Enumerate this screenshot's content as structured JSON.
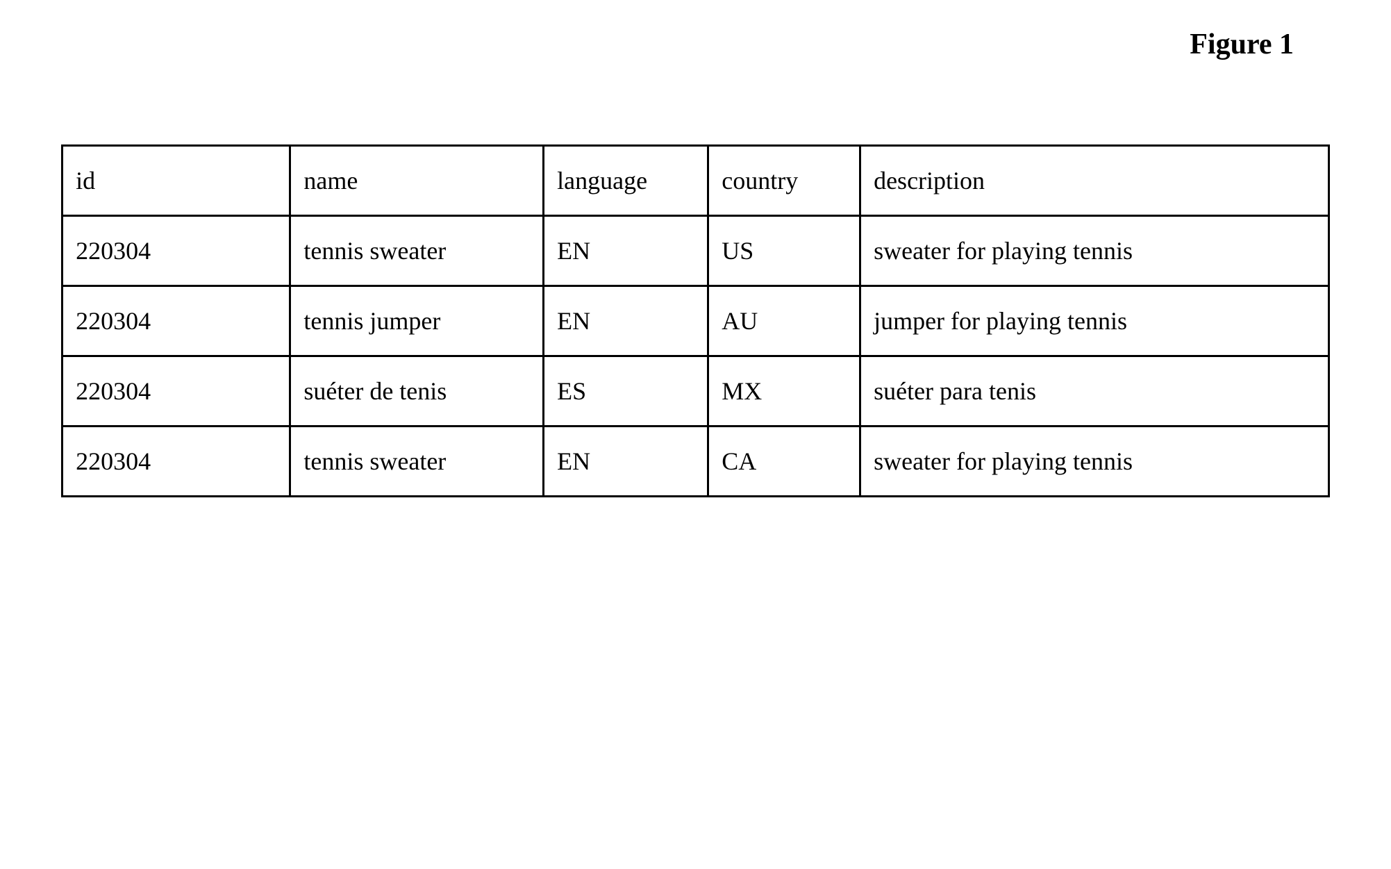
{
  "title": "Figure 1",
  "table": {
    "headers": {
      "id": "id",
      "name": "name",
      "language": "language",
      "country": "country",
      "description": "description"
    },
    "rows": [
      {
        "id": "220304",
        "name": "tennis sweater",
        "language": "EN",
        "country": "US",
        "description": "sweater for playing tennis"
      },
      {
        "id": "220304",
        "name": "tennis jumper",
        "language": "EN",
        "country": "AU",
        "description": "jumper for playing tennis"
      },
      {
        "id": "220304",
        "name": "suéter de tenis",
        "language": "ES",
        "country": "MX",
        "description": "suéter para tenis"
      },
      {
        "id": "220304",
        "name": "tennis sweater",
        "language": "EN",
        "country": "CA",
        "description": "sweater for playing tennis"
      }
    ]
  }
}
